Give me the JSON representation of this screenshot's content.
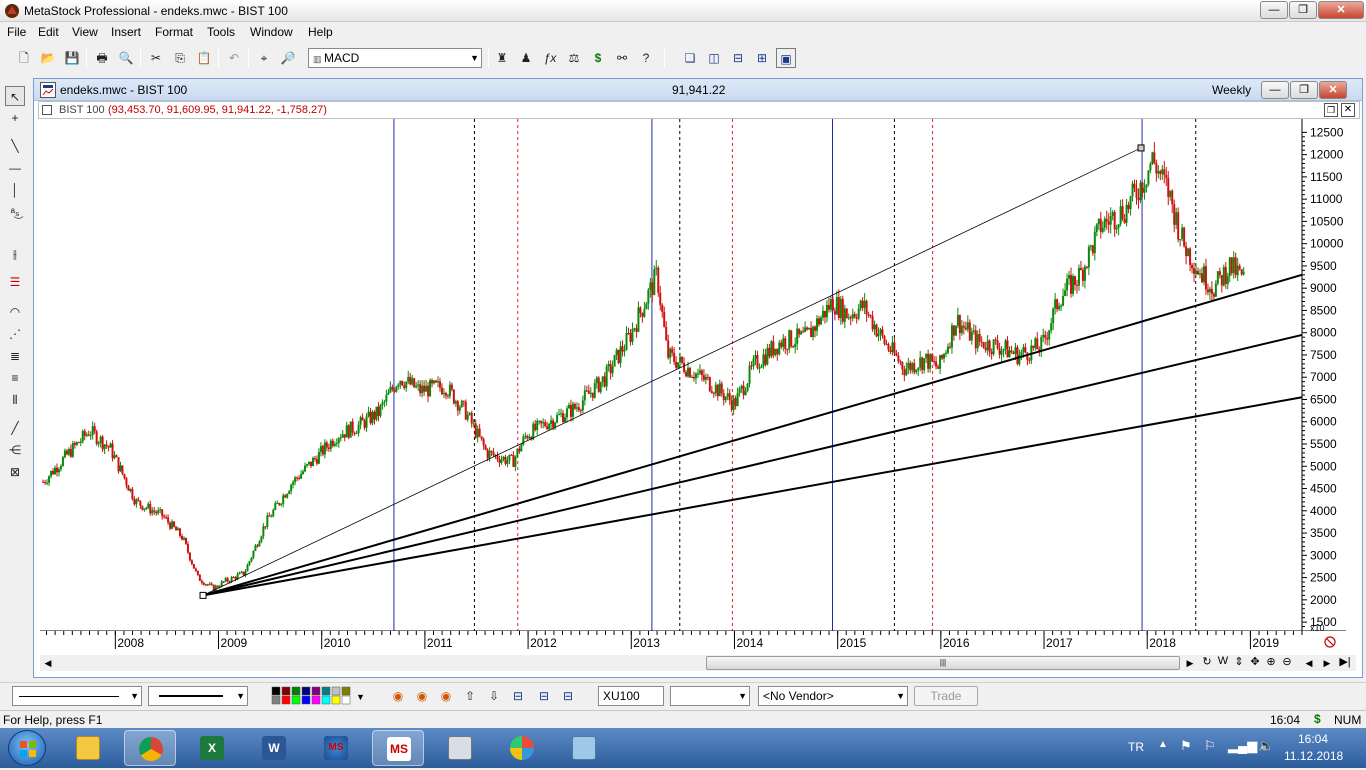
{
  "window": {
    "title": "MetaStock Professional - endeks.mwc - BIST 100"
  },
  "menu": [
    "File",
    "Edit",
    "View",
    "Insert",
    "Format",
    "Tools",
    "Window",
    "Help"
  ],
  "toolbar": {
    "indicator_select": "MACD"
  },
  "chart_window": {
    "title": "endeks.mwc - BIST 100",
    "last_value": "91,941.22",
    "periodicity": "Weekly",
    "security_label": "BIST 100",
    "security_values": "(93,453.70, 91,609.95, 91,941.22, -1,758.27)",
    "scale_multiplier": "x10"
  },
  "chart_data": {
    "type": "candlestick",
    "title": "",
    "xlabel": "",
    "ylabel": "",
    "ylim": [
      1300,
      12800
    ],
    "y_ticks": [
      1500,
      2000,
      2500,
      3000,
      3500,
      4000,
      4500,
      5000,
      5500,
      6000,
      6500,
      7000,
      7500,
      8000,
      8500,
      9000,
      9500,
      10000,
      10500,
      11000,
      11500,
      12000,
      12500
    ],
    "x_ticks": [
      "2008",
      "2009",
      "2010",
      "2011",
      "2012",
      "2013",
      "2014",
      "2015",
      "2016",
      "2017",
      "2018",
      "2019"
    ],
    "x_range": [
      2007.27,
      2019.5
    ],
    "series": [
      {
        "values_approx": [
          [
            2007.3,
            4650
          ],
          [
            2007.55,
            5300
          ],
          [
            2007.75,
            5800
          ],
          [
            2007.95,
            5400
          ],
          [
            2008.2,
            4200
          ],
          [
            2008.45,
            3900
          ],
          [
            2008.65,
            3400
          ],
          [
            2008.8,
            2500
          ],
          [
            2008.95,
            2250
          ],
          [
            2009.05,
            2400
          ],
          [
            2009.25,
            2600
          ],
          [
            2009.45,
            3700
          ],
          [
            2009.7,
            4600
          ],
          [
            2009.95,
            5200
          ],
          [
            2010.15,
            5700
          ],
          [
            2010.35,
            5900
          ],
          [
            2010.55,
            6200
          ],
          [
            2010.75,
            7000
          ],
          [
            2010.95,
            6700
          ],
          [
            2011.2,
            6800
          ],
          [
            2011.4,
            6200
          ],
          [
            2011.6,
            5300
          ],
          [
            2011.85,
            5100
          ],
          [
            2011.98,
            5700
          ],
          [
            2012.2,
            6000
          ],
          [
            2012.45,
            6300
          ],
          [
            2012.75,
            7000
          ],
          [
            2012.98,
            7900
          ],
          [
            2013.25,
            9300
          ],
          [
            2013.35,
            7500
          ],
          [
            2013.55,
            7200
          ],
          [
            2013.8,
            6800
          ],
          [
            2014.0,
            6400
          ],
          [
            2014.2,
            7300
          ],
          [
            2014.45,
            7800
          ],
          [
            2014.7,
            7900
          ],
          [
            2014.95,
            8700
          ],
          [
            2015.1,
            8400
          ],
          [
            2015.25,
            8600
          ],
          [
            2015.45,
            7800
          ],
          [
            2015.65,
            7200
          ],
          [
            2015.85,
            7400
          ],
          [
            2015.98,
            7200
          ],
          [
            2016.15,
            8300
          ],
          [
            2016.35,
            7800
          ],
          [
            2016.55,
            7700
          ],
          [
            2016.75,
            7500
          ],
          [
            2016.98,
            7700
          ],
          [
            2017.15,
            8800
          ],
          [
            2017.35,
            9300
          ],
          [
            2017.55,
            10400
          ],
          [
            2017.8,
            10800
          ],
          [
            2017.98,
            11500
          ],
          [
            2018.05,
            11900
          ],
          [
            2018.2,
            11200
          ],
          [
            2018.35,
            10000
          ],
          [
            2018.5,
            9400
          ],
          [
            2018.65,
            9000
          ],
          [
            2018.8,
            9500
          ],
          [
            2018.94,
            9200
          ]
        ]
      }
    ],
    "vertical_lines": [
      {
        "x": 2010.7,
        "color": "blue",
        "style": "solid"
      },
      {
        "x": 2011.48,
        "color": "black",
        "style": "dashed"
      },
      {
        "x": 2011.9,
        "color": "red",
        "style": "dashed"
      },
      {
        "x": 2013.2,
        "color": "blue",
        "style": "solid"
      },
      {
        "x": 2013.47,
        "color": "black",
        "style": "dashed"
      },
      {
        "x": 2013.98,
        "color": "red",
        "style": "dashed"
      },
      {
        "x": 2014.95,
        "color": "blue",
        "style": "solid"
      },
      {
        "x": 2015.55,
        "color": "black",
        "style": "dashed"
      },
      {
        "x": 2015.92,
        "color": "red",
        "style": "dashed"
      },
      {
        "x": 2017.95,
        "color": "blue",
        "style": "solid"
      },
      {
        "x": 2018.47,
        "color": "black",
        "style": "dashed"
      }
    ],
    "trend_lines": [
      {
        "from": [
          2008.85,
          2100
        ],
        "to": [
          2017.94,
          12150
        ],
        "weight": "thin"
      },
      {
        "from": [
          2008.85,
          2100
        ],
        "to": [
          2019.5,
          9300
        ],
        "weight": "thick"
      },
      {
        "from": [
          2008.85,
          2100
        ],
        "to": [
          2019.5,
          7950
        ],
        "weight": "thick"
      },
      {
        "from": [
          2008.85,
          2100
        ],
        "to": [
          2019.5,
          6550
        ],
        "weight": "thick"
      }
    ]
  },
  "bottom_toolbar": {
    "symbol": "XU100",
    "vendor": "<No Vendor>",
    "trade_label": "Trade"
  },
  "statusbar": {
    "help": "For Help, press F1",
    "time": "16:04",
    "num": "NUM"
  },
  "taskbar": {
    "lang": "TR",
    "time": "16:04",
    "date": "11.12.2018"
  }
}
